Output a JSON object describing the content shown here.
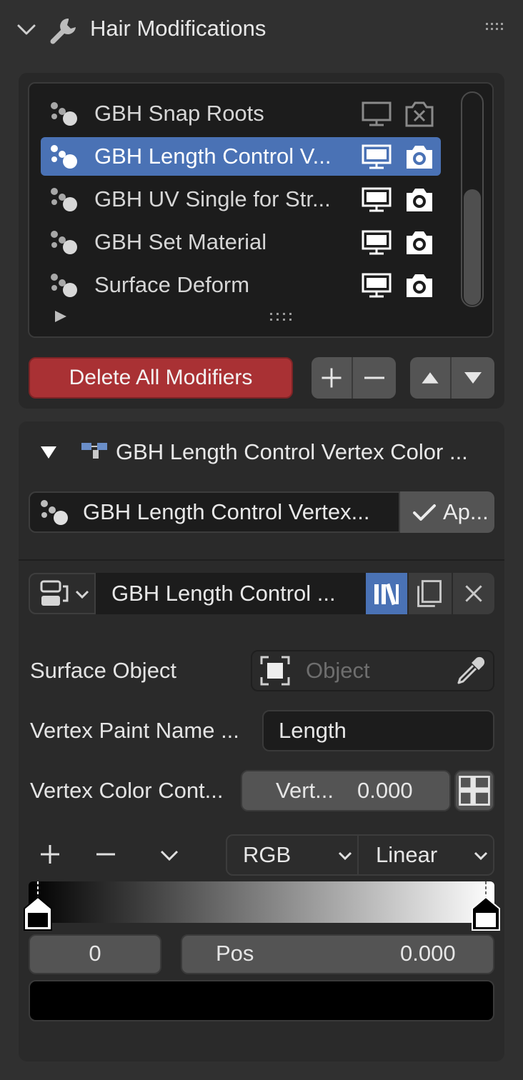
{
  "header": {
    "title": "Hair Modifications",
    "icons": {
      "collapse": "chevron-down-icon",
      "wrench": "wrench-icon",
      "drag": "drag-handle-icon"
    }
  },
  "modifier_list": {
    "items": [
      {
        "label": "GBH Snap Roots",
        "active": false,
        "show_viewport": false,
        "show_render": false
      },
      {
        "label": "GBH Length Control V...",
        "active": true,
        "show_viewport": true,
        "show_render": true
      },
      {
        "label": "GBH UV Single for Str...",
        "active": false,
        "show_viewport": true,
        "show_render": true
      },
      {
        "label": "GBH Set Material",
        "active": false,
        "show_viewport": true,
        "show_render": true
      },
      {
        "label": "Surface Deform",
        "active": false,
        "show_viewport": true,
        "show_render": true
      }
    ],
    "delete_all_label": "Delete All Modifiers",
    "colors": {
      "active_row": "#4a72b5",
      "delete_button": "#a93134"
    }
  },
  "subpanel": {
    "title": "GBH Length Control Vertex Color ...",
    "node_group_label": "GBH Length Control Vertex...",
    "apply_label": "Ap...",
    "datablock_name": "GBH Length Control ..."
  },
  "properties": {
    "surface_object": {
      "label": "Surface Object",
      "placeholder": "Object"
    },
    "vertex_paint_name": {
      "label": "Vertex Paint Name ...",
      "value": "Length"
    },
    "vertex_color_control": {
      "label": "Vertex Color Cont...",
      "field_label": "Vert...",
      "value": "0.000"
    }
  },
  "color_ramp": {
    "color_mode": "RGB",
    "interpolation": "Linear",
    "stops": [
      {
        "position": 0.0,
        "color": "#000000"
      },
      {
        "position": 1.0,
        "color": "#ffffff"
      }
    ],
    "active_index": "0",
    "pos_label": "Pos",
    "pos_value": "0.000",
    "active_color": "#000000"
  }
}
